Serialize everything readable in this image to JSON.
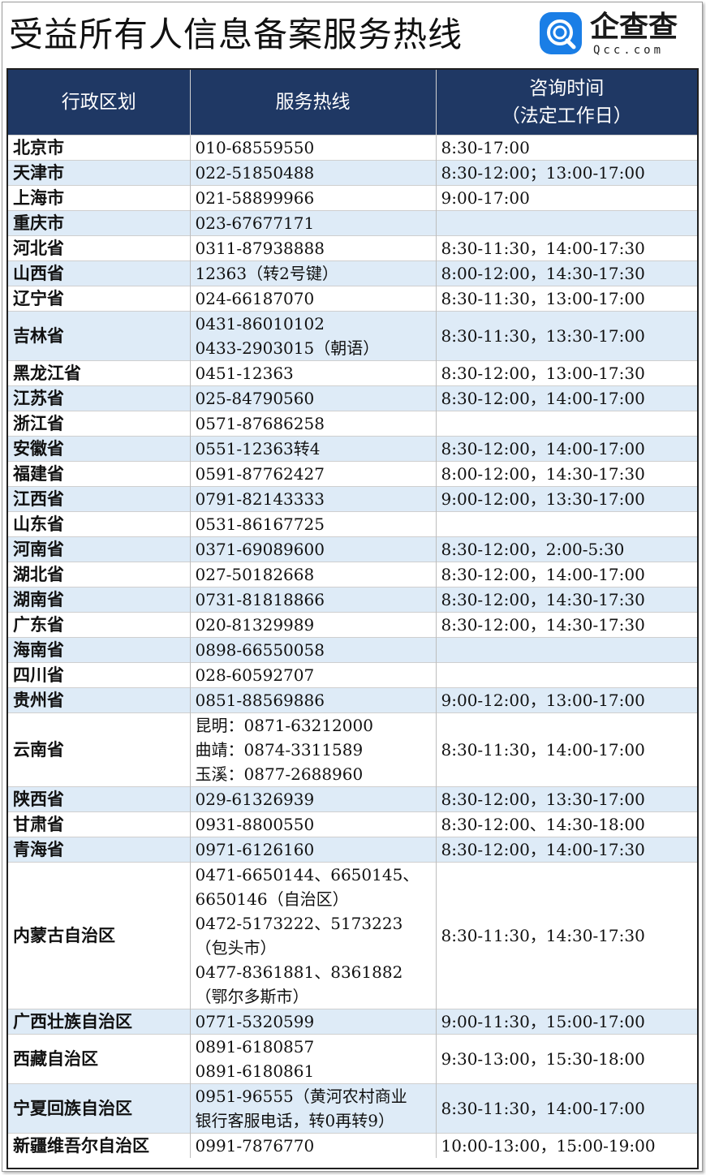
{
  "header": {
    "title": "受益所有人信息备案服务热线",
    "logo_name": "企查查",
    "logo_domain": "Qcc.com",
    "logo_color": "#1a7ee6"
  },
  "table": {
    "col_region": "行政区划",
    "col_hotline": "服务热线",
    "col_hours_line1": "咨询时间",
    "col_hours_line2": "（法定工作日）",
    "header_bg": "#1f3864",
    "stripe_bg": "#deebf7",
    "rows": [
      {
        "region": "北京市",
        "phones": [
          "010-68559550"
        ],
        "hours": "8:30-17:00"
      },
      {
        "region": "天津市",
        "phones": [
          "022-51850488"
        ],
        "hours": "8:30-12:00；13:00-17:00"
      },
      {
        "region": "上海市",
        "phones": [
          "021-58899966"
        ],
        "hours": "9:00-17:00"
      },
      {
        "region": "重庆市",
        "phones": [
          "023-67677171"
        ],
        "hours": ""
      },
      {
        "region": "河北省",
        "phones": [
          "0311-87938888"
        ],
        "hours": "8:30-11:30，14:00-17:30"
      },
      {
        "region": "山西省",
        "phones": [
          "12363（转2号键）"
        ],
        "hours": "8:00-12:00，14:30-17:30"
      },
      {
        "region": "辽宁省",
        "phones": [
          "024-66187070"
        ],
        "hours": "8:30-11:30，13:00-17:00"
      },
      {
        "region": "吉林省",
        "phones": [
          "0431-86010102",
          "0433-2903015（朝语）"
        ],
        "hours": "8:30-11:30，13:30-17:00"
      },
      {
        "region": "黑龙江省",
        "phones": [
          "0451-12363"
        ],
        "hours": "8:30-12:00，13:00-17:30"
      },
      {
        "region": "江苏省",
        "phones": [
          "025-84790560"
        ],
        "hours": "8:30-12:00，14:00-17:00"
      },
      {
        "region": "浙江省",
        "phones": [
          "0571-87686258"
        ],
        "hours": ""
      },
      {
        "region": "安徽省",
        "phones": [
          "0551-12363转4"
        ],
        "hours": "8:30-12:00，14:00-17:00"
      },
      {
        "region": "福建省",
        "phones": [
          "0591-87762427"
        ],
        "hours": "8:00-12:00，14:30-17:30"
      },
      {
        "region": "江西省",
        "phones": [
          "0791-82143333"
        ],
        "hours": "9:00-12:00，13:30-17:00"
      },
      {
        "region": "山东省",
        "phones": [
          "0531-86167725"
        ],
        "hours": ""
      },
      {
        "region": "河南省",
        "phones": [
          "0371-69089600"
        ],
        "hours": "8:30-12:00，2:00-5:30"
      },
      {
        "region": "湖北省",
        "phones": [
          "027-50182668"
        ],
        "hours": "8:30-12:00，14:00-17:00"
      },
      {
        "region": "湖南省",
        "phones": [
          "0731-81818866"
        ],
        "hours": "8:30-12:00，14:30-17:30"
      },
      {
        "region": "广东省",
        "phones": [
          "020-81329989"
        ],
        "hours": "8:30-12:00，14:30-17:30"
      },
      {
        "region": "海南省",
        "phones": [
          "0898-66550058"
        ],
        "hours": ""
      },
      {
        "region": "四川省",
        "phones": [
          "028-60592707"
        ],
        "hours": ""
      },
      {
        "region": "贵州省",
        "phones": [
          "0851-88569886"
        ],
        "hours": "9:00-12:00，13:00-17:00"
      },
      {
        "region": "云南省",
        "phones": [
          "昆明：0871-63212000",
          "曲靖：0874-3311589",
          "玉溪：0877-2688960"
        ],
        "hours": "8:30-11:30，14:00-17:00"
      },
      {
        "region": "陕西省",
        "phones": [
          "029-61326939"
        ],
        "hours": "8:30-12:00，13:30-17:00"
      },
      {
        "region": "甘肃省",
        "phones": [
          "0931-8800550"
        ],
        "hours": "8:30-12:00、14:30-18:00"
      },
      {
        "region": "青海省",
        "phones": [
          "0971-6126160"
        ],
        "hours": "8:30-12:00，14:00-17:30"
      },
      {
        "region": "内蒙古自治区",
        "phones": [
          "0471-6650144、6650145、",
          "6650146（自治区）",
          "0472-5173222、5173223",
          "（包头市）",
          "0477-8361881、8361882",
          "（鄂尔多斯市）"
        ],
        "hours": "8:30-11:30，14:30-17:30"
      },
      {
        "region": "广西壮族自治区",
        "phones": [
          "0771-5320599"
        ],
        "hours": "9:00-11:30，15:00-17:00"
      },
      {
        "region": "西藏自治区",
        "phones": [
          "0891-6180857",
          "0891-6180861"
        ],
        "hours": "9:30-13:00，15:30-18:00"
      },
      {
        "region": "宁夏回族自治区",
        "phones": [
          "0951-96555（黄河农村商业",
          "银行客服电话，转0再转9）"
        ],
        "hours": "8:30-11:30，14:00-17:00"
      },
      {
        "region": "新疆维吾尔自治区",
        "phones": [
          "0991-7876770"
        ],
        "hours": "10:00-13:00，15:00-19:00"
      }
    ]
  }
}
